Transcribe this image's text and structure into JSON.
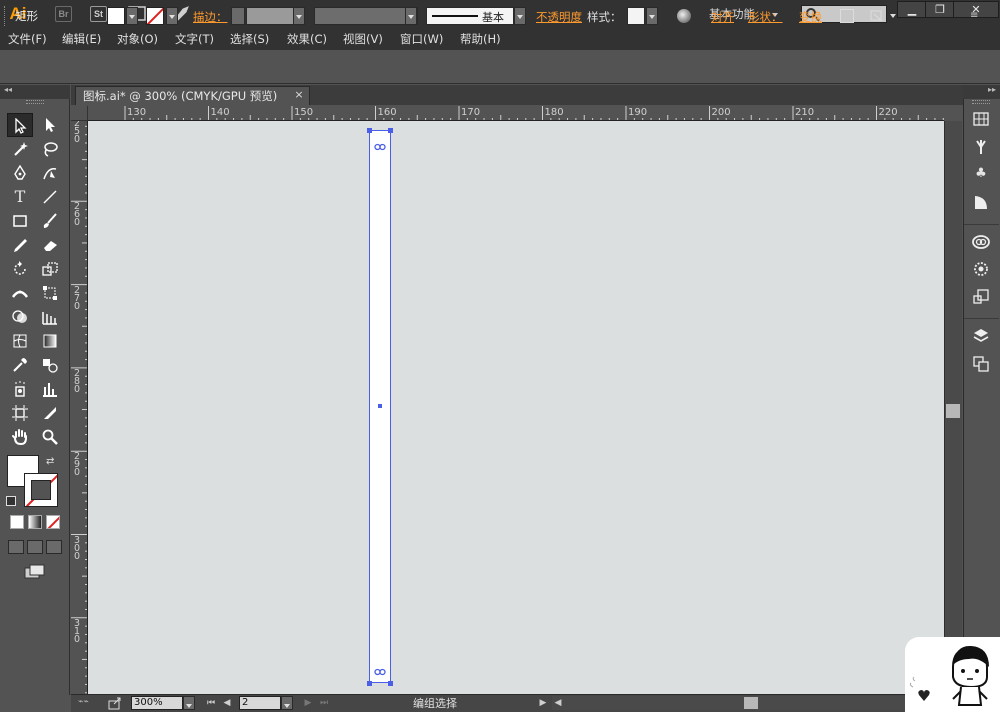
{
  "app": {
    "logo": "Ai",
    "bridge_label": "Br",
    "stock_label": "St",
    "workspace": "基本功能",
    "search_placeholder": ""
  },
  "menu": [
    "文件(F)",
    "编辑(E)",
    "对象(O)",
    "文字(T)",
    "选择(S)",
    "效果(C)",
    "视图(V)",
    "窗口(W)",
    "帮助(H)"
  ],
  "control": {
    "tool_name": "矩形",
    "stroke_label": "描边：",
    "brush_name": "基本",
    "opacity_label": "不透明度",
    "style_label": "样式：",
    "align_label": "对齐",
    "shape_label": "形状：",
    "transform_label": "变换"
  },
  "document": {
    "tab_title": "图标.ai* @ 300% (CMYK/GPU 预览)",
    "close": "×"
  },
  "ruler": {
    "top": [
      "130",
      "140",
      "150",
      "160",
      "170",
      "180",
      "190",
      "200",
      "210",
      "220"
    ],
    "left": [
      "250",
      "260",
      "270",
      "280",
      "290",
      "300",
      "310"
    ]
  },
  "status": {
    "zoom": "300%",
    "page": "2",
    "text": "编组选择"
  },
  "colors": {
    "accent": "#ff9a2e",
    "selection": "#4a5ee8",
    "canvas": "#dcdfdf",
    "ui_bg": "#535353"
  },
  "icons": {
    "tools": [
      "selection-icon",
      "direct-selection-icon",
      "magic-wand-icon",
      "lasso-icon",
      "pen-icon",
      "curvature-icon",
      "type-icon",
      "line-segment-icon",
      "rectangle-icon",
      "paintbrush-icon",
      "pencil-icon",
      "eraser-icon",
      "rotate-icon",
      "scale-icon",
      "width-icon",
      "free-transform-icon",
      "shape-builder-icon",
      "perspective-grid-icon",
      "mesh-icon",
      "gradient-icon",
      "eyedropper-icon",
      "blend-icon",
      "symbol-sprayer-icon",
      "column-graph-icon",
      "artboard-icon",
      "slice-icon",
      "hand-icon",
      "zoom-icon"
    ],
    "dock": [
      "swatches-icon",
      "brushes-icon",
      "symbols-icon",
      "graphic-styles-icon",
      "cc-libraries-icon",
      "appearance-icon",
      "transform-panel-icon",
      "layers-icon",
      "artboards-panel-icon"
    ]
  }
}
